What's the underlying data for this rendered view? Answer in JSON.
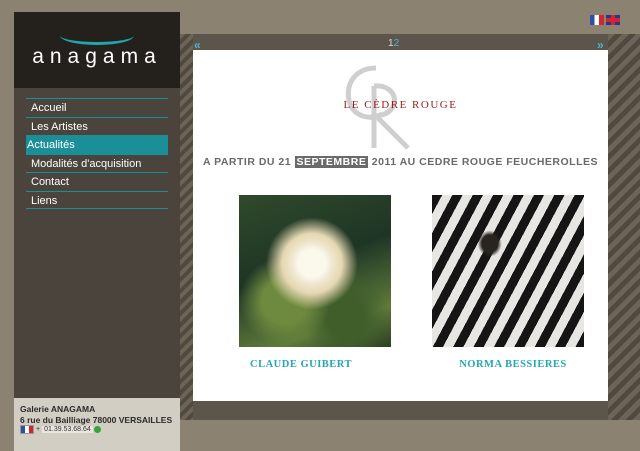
{
  "logo": {
    "text": "anagama"
  },
  "nav": {
    "items": [
      {
        "label": "Accueil",
        "active": false
      },
      {
        "label": "Les Artistes",
        "active": false
      },
      {
        "label": "Actualités",
        "active": true
      },
      {
        "label": "Modalités d'acquisition",
        "active": false
      },
      {
        "label": "Contact",
        "active": false
      },
      {
        "label": "Liens",
        "active": false
      }
    ]
  },
  "footer": {
    "name": "Galerie ANAGAMA",
    "address": "6 rue du Bailliage 78000 VERSAILLES",
    "phone_prefix": "+",
    "phone": "01.39.53.68.64"
  },
  "languages": [
    "flag-fr-icon",
    "flag-uk-icon"
  ],
  "pager": {
    "page1": "1",
    "page2": "2",
    "current": "2"
  },
  "content": {
    "venue": "LE CÈDRE ROUGE",
    "headline_pre": "A PARTIR DU 21",
    "headline_highlight": "SEPTEMBRE",
    "headline_post": "2011 AU CEDRE ROUGE FEUCHEROLLES",
    "artists": [
      {
        "name": "CLAUDE GUIBERT",
        "artwork": "rose-painting"
      },
      {
        "name": "NORMA BESSIERES",
        "artwork": "zebra-painting"
      }
    ]
  },
  "colors": {
    "accent": "#1a8f98",
    "venue_red": "#9b1a1d",
    "artist_teal": "#25a7b2"
  }
}
